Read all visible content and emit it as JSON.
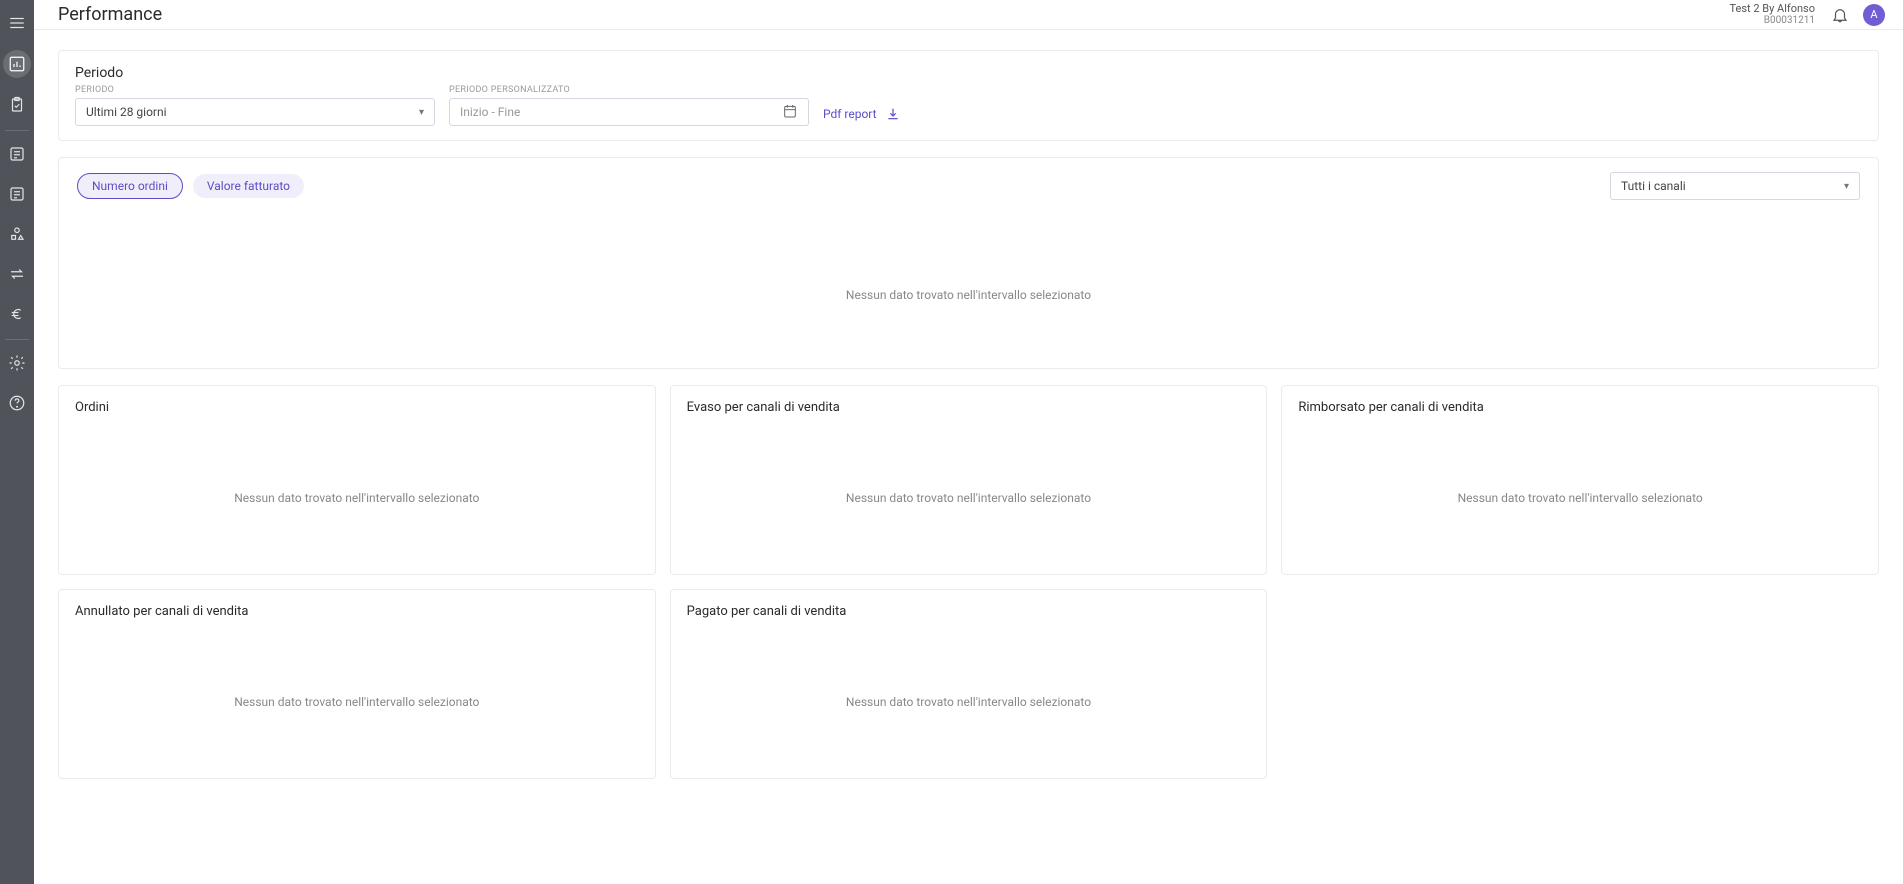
{
  "header": {
    "title": "Performance",
    "account_name": "Test 2 By Alfonso",
    "account_id": "B00031211",
    "avatar_initial": "A"
  },
  "periodo": {
    "section_title": "Periodo",
    "period_label": "PERIODO",
    "period_value": "Ultimi 28 giorni",
    "custom_label": "PERIODO PERSONALIZZATO",
    "custom_placeholder": "Inizio - Fine",
    "pdf_label": "Pdf report"
  },
  "chips": {
    "orders": "Numero ordini",
    "revenue": "Valore fatturato"
  },
  "channels": {
    "selected": "Tutti i canali"
  },
  "empty_text": "Nessun dato trovato nell'intervallo selezionato",
  "cards": {
    "ordini": "Ordini",
    "evaso": "Evaso per canali di vendita",
    "rimborsato": "Rimborsato per canali di vendita",
    "annullato": "Annullato per canali di vendita",
    "pagato": "Pagato per canali di vendita"
  }
}
